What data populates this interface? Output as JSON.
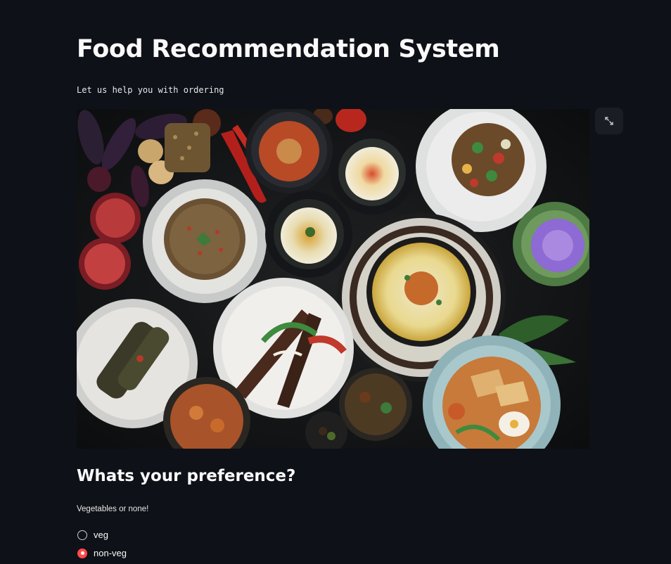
{
  "app": {
    "title": "Food Recommendation System",
    "subtitle": "Let us help you with ordering"
  },
  "hero_image": {
    "icon": "food-platter-photo"
  },
  "toolbar": {
    "expand_icon": "expand-icon"
  },
  "preference": {
    "heading": "Whats your preference?",
    "radio_label": "Vegetables or none!",
    "options": [
      {
        "label": "veg",
        "selected": false
      },
      {
        "label": "non-veg",
        "selected": true
      }
    ]
  },
  "colors": {
    "background": "#0e1117",
    "text": "#fafafa",
    "accent": "#ff4b4b"
  }
}
